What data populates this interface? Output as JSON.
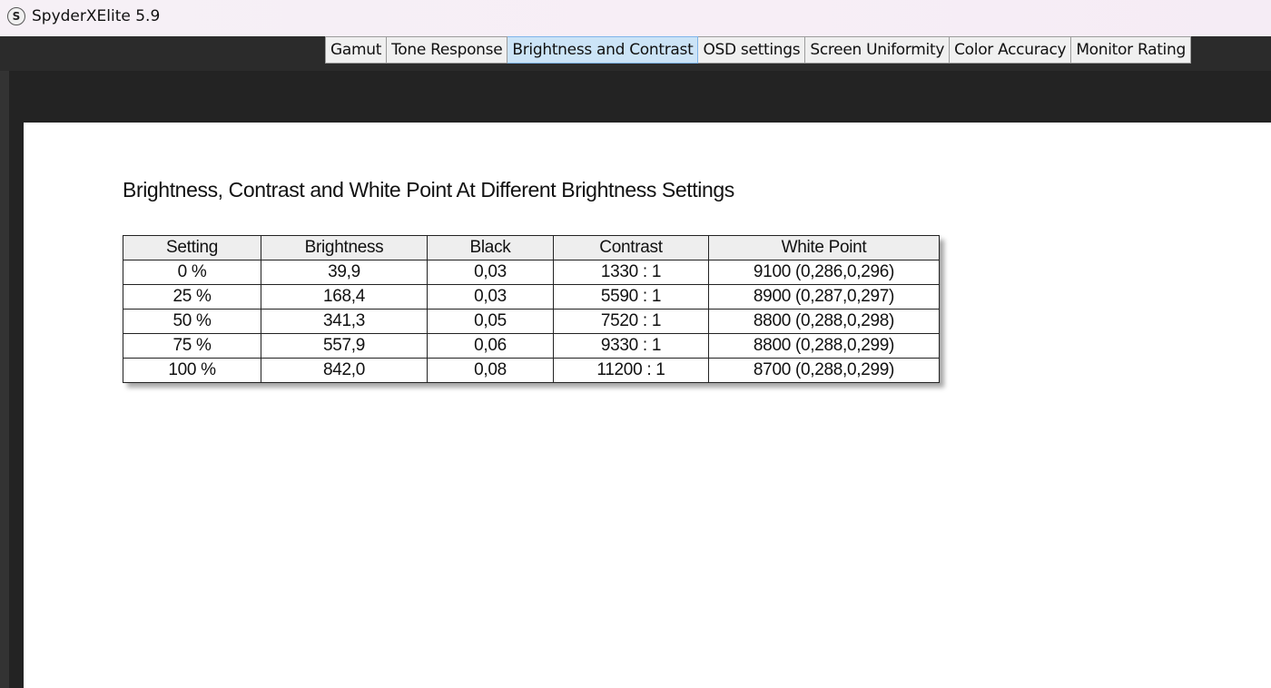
{
  "window": {
    "icon": "spyder-s-icon",
    "icon_glyph": "S",
    "title": "SpyderXElite 5.9"
  },
  "tabs": [
    {
      "label": "Gamut",
      "active": false
    },
    {
      "label": "Tone Response",
      "active": false
    },
    {
      "label": "Brightness and Contrast",
      "active": true
    },
    {
      "label": "OSD settings",
      "active": false
    },
    {
      "label": "Screen Uniformity",
      "active": false
    },
    {
      "label": "Color Accuracy",
      "active": false
    },
    {
      "label": "Monitor Rating",
      "active": false
    }
  ],
  "report": {
    "title": "Brightness, Contrast and White Point At Different Brightness Settings",
    "columns": [
      "Setting",
      "Brightness",
      "Black",
      "Contrast",
      "White Point"
    ],
    "rows": [
      [
        "0 %",
        "39,9",
        "0,03",
        "1330 : 1",
        "9100 (0,286,0,296)"
      ],
      [
        "25 %",
        "168,4",
        "0,03",
        "5590 : 1",
        "8900 (0,287,0,297)"
      ],
      [
        "50 %",
        "341,3",
        "0,05",
        "7520 : 1",
        "8800 (0,288,0,298)"
      ],
      [
        "75 %",
        "557,9",
        "0,06",
        "9330 : 1",
        "8800 (0,288,0,299)"
      ],
      [
        "100 %",
        "842,0",
        "0,08",
        "11200 : 1",
        "8700 (0,288,0,299)"
      ]
    ]
  },
  "colors": {
    "active_tab": "#cce4f7",
    "app_background": "#2a2a2a",
    "page": "#ffffff"
  }
}
